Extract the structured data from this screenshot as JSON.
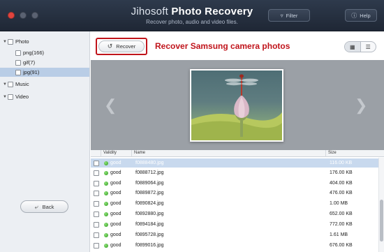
{
  "titlebar": {
    "title_part1": "Jihosoft",
    "title_part2": "Photo Recovery",
    "subtitle": "Recover photo, audio and video files.",
    "filter_label": "Filter",
    "help_label": "Help",
    "filter_icon": "funnel-icon",
    "help_icon": "question-icon"
  },
  "sidebar": {
    "items": [
      {
        "label": "Photo",
        "level": 0,
        "expanded": true
      },
      {
        "label": "png(166)",
        "level": 1
      },
      {
        "label": "gif(7)",
        "level": 1
      },
      {
        "label": "jpg(91)",
        "level": 1,
        "selected": true
      },
      {
        "label": "Music",
        "level": 0,
        "expanded": true
      },
      {
        "label": "Video",
        "level": 0,
        "expanded": true
      }
    ],
    "back_label": "Back"
  },
  "toolbar": {
    "recover_label": "Recover",
    "headline": "Recover Samsung camera photos",
    "accent_color": "#c0141b"
  },
  "table": {
    "headers": {
      "validity": "Validity",
      "name": "Name",
      "size": "Size"
    },
    "rows": [
      {
        "validity": "good",
        "name": "f0888480.jpg",
        "size": "116.00 KB",
        "selected": true
      },
      {
        "validity": "good",
        "name": "f0888712.jpg",
        "size": "176.00 KB"
      },
      {
        "validity": "good",
        "name": "f0889064.jpg",
        "size": "404.00 KB"
      },
      {
        "validity": "good",
        "name": "f0889872.jpg",
        "size": "476.00 KB"
      },
      {
        "validity": "good",
        "name": "f0890824.jpg",
        "size": "1.00 MB"
      },
      {
        "validity": "good",
        "name": "f0892880.jpg",
        "size": "652.00 KB"
      },
      {
        "validity": "good",
        "name": "f0894184.jpg",
        "size": "772.00 KB"
      },
      {
        "validity": "good",
        "name": "f0895728.jpg",
        "size": "1.61 MB"
      },
      {
        "validity": "good",
        "name": "f0899016.jpg",
        "size": "676.00 KB"
      }
    ]
  }
}
